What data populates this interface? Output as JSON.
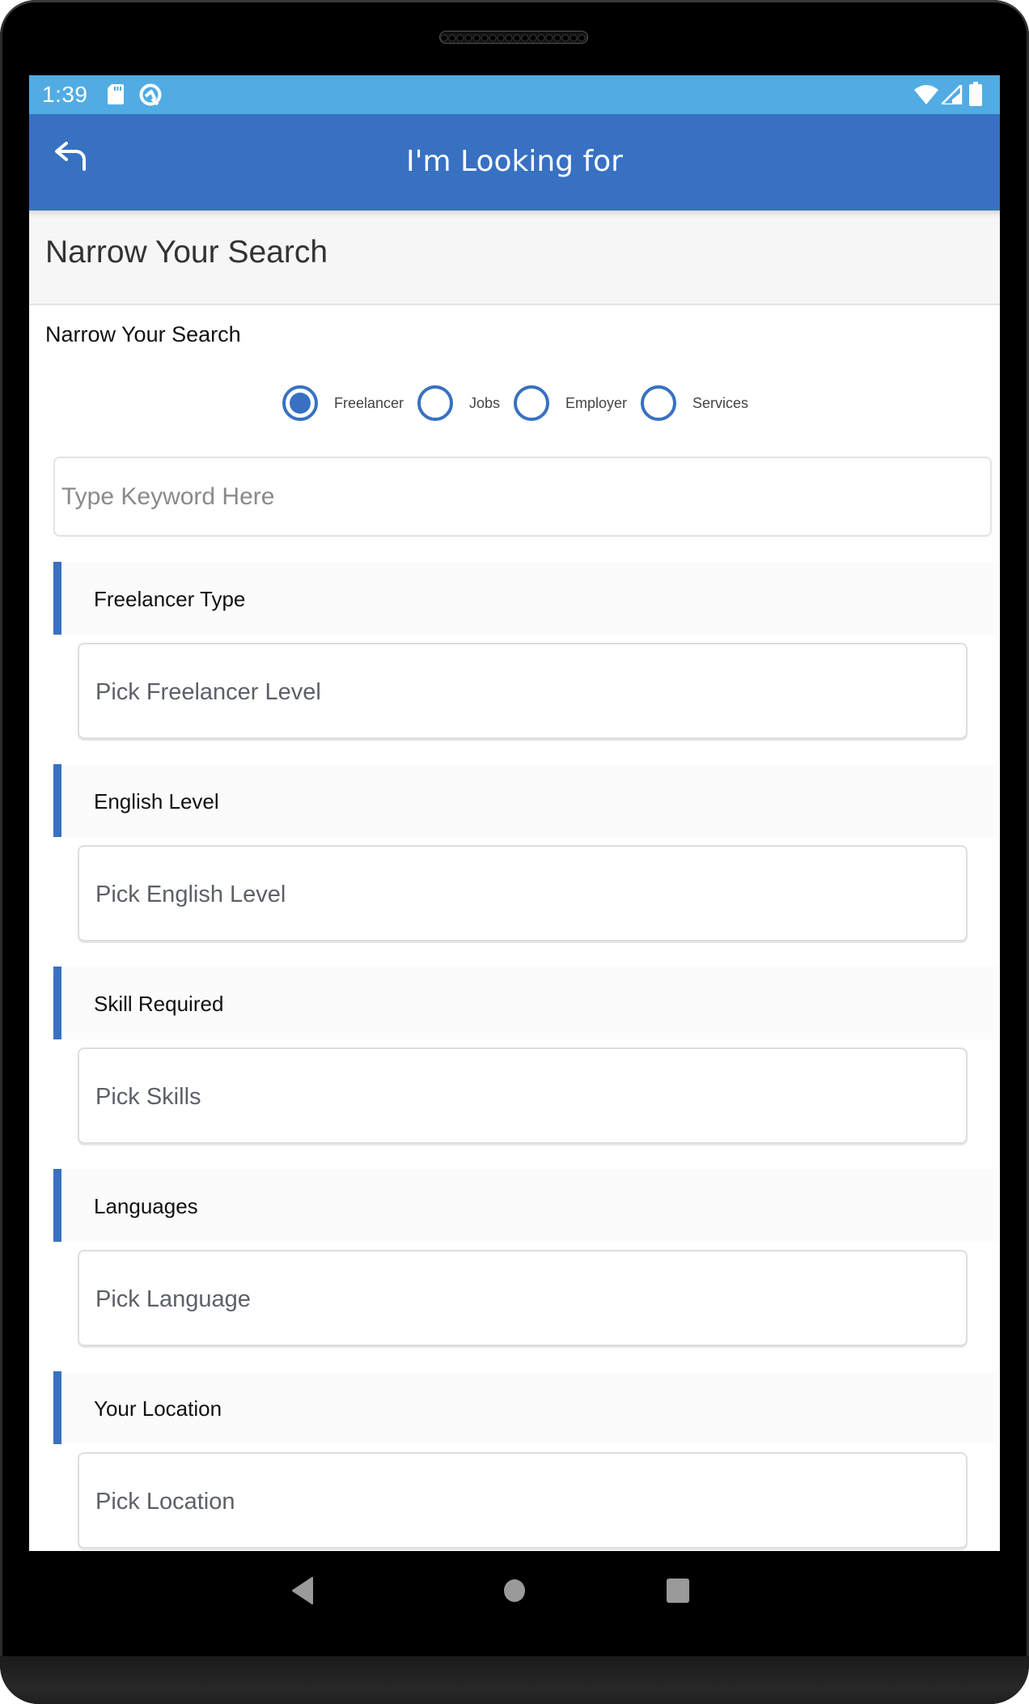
{
  "status_bar": {
    "time": "1:39",
    "left_icons": [
      "sd-card-icon",
      "q-logo-icon"
    ],
    "right_icons": [
      "wifi-icon",
      "signal-icon",
      "battery-icon"
    ]
  },
  "app_bar": {
    "back_icon": "undo-arrow-icon",
    "title": "I'm Looking for"
  },
  "subheader": {
    "title": "Narrow Your Search"
  },
  "search_type": {
    "label": "Narrow Your Search",
    "options": [
      {
        "label": "Freelancer",
        "selected": true
      },
      {
        "label": "Jobs",
        "selected": false
      },
      {
        "label": "Employer",
        "selected": false
      },
      {
        "label": "Services",
        "selected": false
      }
    ]
  },
  "keyword": {
    "placeholder": "Type Keyword Here",
    "value": ""
  },
  "sections": [
    {
      "title": "Freelancer Type",
      "placeholder": "Pick Freelancer Level"
    },
    {
      "title": "English Level",
      "placeholder": "Pick English Level"
    },
    {
      "title": "Skill Required",
      "placeholder": "Pick Skills"
    },
    {
      "title": "Languages",
      "placeholder": "Pick Language"
    },
    {
      "title": "Your Location",
      "placeholder": "Pick Location"
    }
  ],
  "nav_bar": {
    "buttons": [
      "back-triangle-icon",
      "home-circle-icon",
      "recents-square-icon"
    ]
  },
  "colors": {
    "status_bar": "#51ace3",
    "app_bar": "#3871c2",
    "accent": "#3871c2"
  }
}
